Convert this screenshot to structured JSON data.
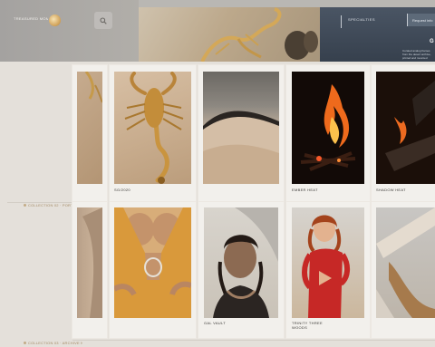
{
  "header": {
    "logo_text": "TREASURED MOMENTS",
    "search_icon": "search-icon",
    "nav_link": "SPECIALTIES",
    "nav_cta": "Request info",
    "hero_badge": "G",
    "hero_caption": "Curated analog frames from the desert archive, printed and mounted"
  },
  "rows": [
    {
      "label": "COLLECTION 01 · DESERT SERIES"
    },
    {
      "label": "COLLECTION 02 · PORTRAIT STUDIES"
    },
    {
      "label": "COLLECTION 03 · ARCHIVE NOTES"
    }
  ],
  "cards": [
    {
      "id": "scorpion",
      "caption": "SG/2020",
      "scene": "scorpion"
    },
    {
      "id": "dunes",
      "caption": "",
      "scene": "dunes"
    },
    {
      "id": "ember-heat",
      "caption": "EMBER HEAT",
      "scene": "fire"
    },
    {
      "id": "shadow-heat",
      "caption": "SHADOW HEAT",
      "scene": "fire-dark"
    },
    {
      "id": "ochre-dress",
      "caption": "",
      "scene": "dress"
    },
    {
      "id": "gal-vault",
      "caption": "GAL VAULT",
      "scene": "portrait"
    },
    {
      "id": "trinity",
      "caption": "TRINITY THREE\nWOODS",
      "scene": "red-dress"
    },
    {
      "id": "driftwood",
      "caption": "",
      "scene": "driftwood"
    }
  ],
  "colors": {
    "accent": "#c3ab86",
    "card": "#f2f0ec",
    "background": "#e4e0da"
  }
}
